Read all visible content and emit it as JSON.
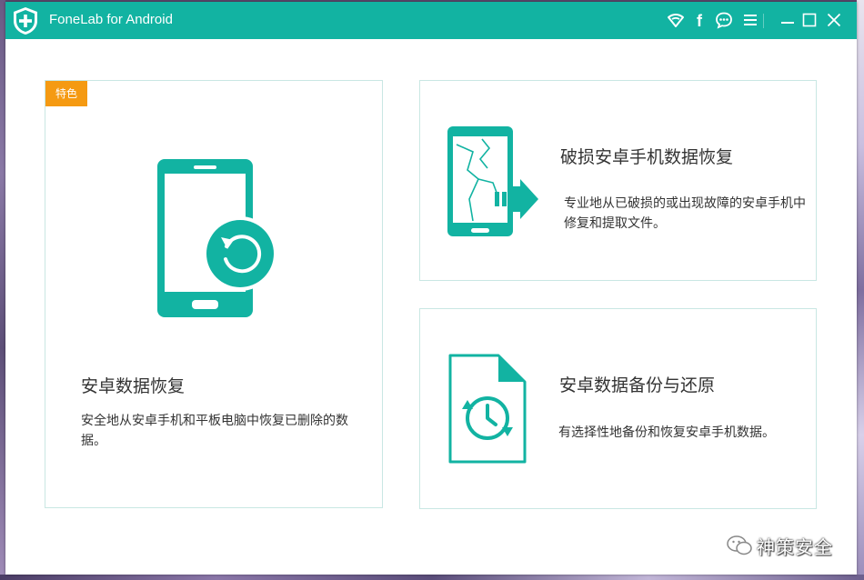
{
  "window": {
    "title": "FoneLab for Android"
  },
  "titlebar": {
    "icons": [
      "wifi-icon",
      "facebook-icon",
      "chat-icon",
      "menu-icon",
      "minimize-icon",
      "maximize-icon",
      "close-icon"
    ],
    "facebook_glyph": "f"
  },
  "cards": {
    "main": {
      "badge": "特色",
      "title": "安卓数据恢复",
      "description": "安全地从安卓手机和平板电脑中恢复已删除的数据。",
      "icon": "phone-restore-icon"
    },
    "broken": {
      "title": "破损安卓手机数据恢复",
      "description": "专业地从已破损的或出现故障的安卓手机中修复和提取文件。",
      "icon": "broken-phone-icon"
    },
    "backup": {
      "title": "安卓数据备份与还原",
      "description": "有选择性地备份和恢复安卓手机数据。",
      "icon": "file-clock-icon"
    }
  },
  "watermark": {
    "text": "神策安全"
  },
  "colors": {
    "accent": "#12b3a2",
    "badge": "#f59a12",
    "card_border": "#c9e7e3",
    "text": "#333333"
  }
}
